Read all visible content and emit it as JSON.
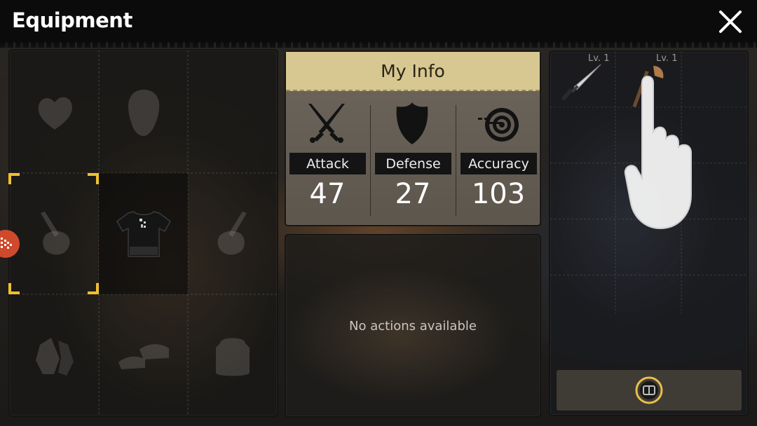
{
  "header": {
    "title": "Equipment",
    "close_icon": "close-icon"
  },
  "equipment_slots": [
    {
      "slot": "head-alt",
      "icon": "heart-shape-icon",
      "state": "empty"
    },
    {
      "slot": "head",
      "icon": "head-silhouette-icon",
      "state": "empty"
    },
    {
      "slot": "empty-top-right",
      "icon": null,
      "state": "empty"
    },
    {
      "slot": "left-hand",
      "icon": "hand-weapon-icon",
      "state": "empty",
      "selected": true
    },
    {
      "slot": "body",
      "icon": "t-shirt-icon",
      "state": "equipped"
    },
    {
      "slot": "right-hand",
      "icon": "hand-weapon-icon",
      "state": "empty"
    },
    {
      "slot": "hands",
      "icon": "gloves-icon",
      "state": "empty"
    },
    {
      "slot": "feet",
      "icon": "shoes-icon",
      "state": "empty"
    },
    {
      "slot": "back",
      "icon": "backpack-icon",
      "state": "empty"
    }
  ],
  "my_info": {
    "title": "My Info",
    "stats": [
      {
        "label": "Attack",
        "value": "47",
        "icon": "crossed-swords-icon"
      },
      {
        "label": "Defense",
        "value": "27",
        "icon": "shield-icon"
      },
      {
        "label": "Accuracy",
        "value": "103",
        "icon": "target-icon"
      }
    ]
  },
  "actions": {
    "empty_text": "No actions available"
  },
  "inventory": {
    "items": [
      {
        "icon": "knife-icon",
        "level": "Lv. 1"
      },
      {
        "icon": "axe-icon",
        "level": "Lv. 1"
      }
    ],
    "bag_button_icon": "bag-icon"
  },
  "colors": {
    "selection_bracket": "#f0c030",
    "info_header_bg": "#d7c891",
    "side_tab": "#cf4a2c"
  }
}
